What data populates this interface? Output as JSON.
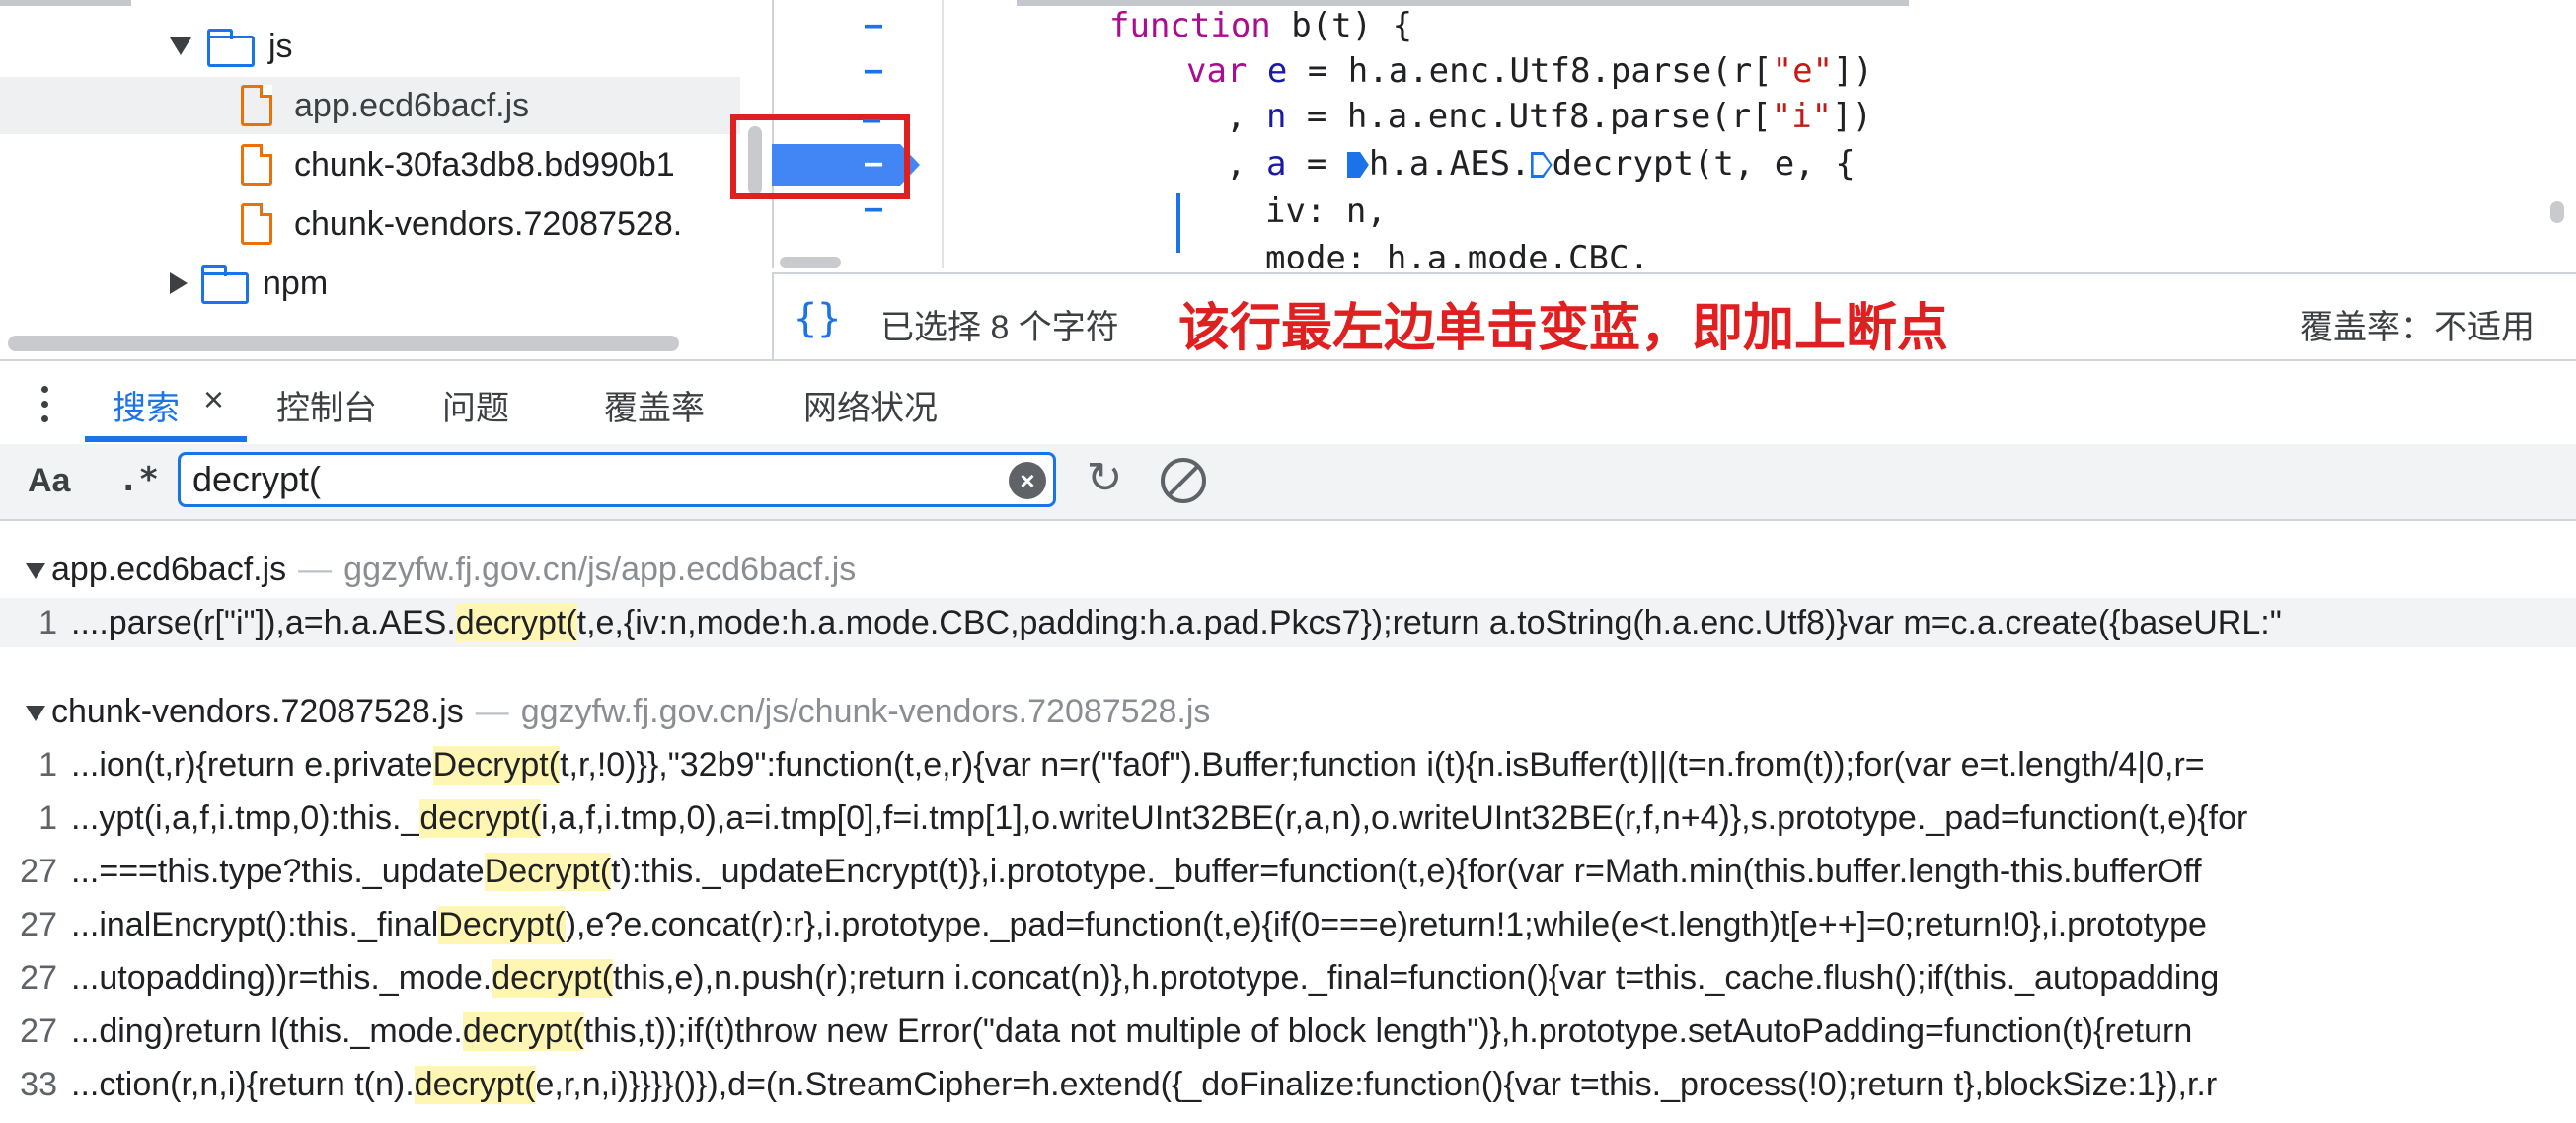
{
  "tree": {
    "folder_js": "js",
    "files": [
      "app.ecd6bacf.js",
      "chunk-30fa3db8.bd990b1",
      "chunk-vendors.72087528."
    ],
    "folder_npm": "npm"
  },
  "editor": {
    "lines": [
      {
        "kw": "function",
        "rest": " b(t) {"
      },
      {
        "kw": "var",
        "v": " e",
        "rest1": " = h.a.enc.Utf8.parse(r[",
        "s": "\"e\"",
        "rest2": "])"
      },
      {
        "pre": ", ",
        "v": "n",
        "rest1": " = h.a.enc.Utf8.parse(r[",
        "s": "\"i\"",
        "rest2": "])"
      },
      {
        "pre": ", ",
        "v": "a",
        "rest1": " = ",
        "p1": "h.a.AES.",
        "p2": "decrypt(t, e, {"
      },
      {
        "text": "iv: n,"
      },
      {
        "text": "mode: h.a.mode.CBC,"
      }
    ],
    "gutter_dashes": [
      "–",
      "–",
      "–",
      "–",
      "–"
    ]
  },
  "status": {
    "braces": "{}",
    "selection": "已选择 8 个字符",
    "annotation": "该行最左边单击变蓝，即加上断点",
    "coverage": "覆盖率：不适用"
  },
  "tabs": {
    "search": "搜索",
    "console": "控制台",
    "issues": "问题",
    "coverage": "覆盖率",
    "network": "网络状况",
    "close": "×"
  },
  "search": {
    "case_toggle": "Aa",
    "regex_toggle": ".*",
    "query": "decrypt(",
    "clear": "×",
    "refresh": "↻"
  },
  "results": {
    "groups": [
      {
        "file": "app.ecd6bacf.js",
        "url": "ggzyfw.fj.gov.cn/js/app.ecd6bacf.js",
        "rows": [
          {
            "line": "1",
            "pre": "....parse(r[\"i\"]),a=h.a.AES.",
            "match": "decrypt(",
            "post": "t,e,{iv:n,mode:h.a.mode.CBC,padding:h.a.pad.Pkcs7});return a.toString(h.a.enc.Utf8)}var m=c.a.create({baseURL:\""
          }
        ]
      },
      {
        "file": "chunk-vendors.72087528.js",
        "url": "ggzyfw.fj.gov.cn/js/chunk-vendors.72087528.js",
        "rows": [
          {
            "line": "1",
            "pre": "...ion(t,r){return e.private",
            "match": "Decrypt(",
            "post": "t,r,!0)}},\"32b9\":function(t,e,r){var n=r(\"fa0f\").Buffer;function i(t){n.isBuffer(t)||(t=n.from(t));for(var e=t.length/4|0,r="
          },
          {
            "line": "1",
            "pre": "...ypt(i,a,f,i.tmp,0):this._",
            "match": "decrypt(",
            "post": "i,a,f,i.tmp,0),a=i.tmp[0],f=i.tmp[1],o.writeUInt32BE(r,a,n),o.writeUInt32BE(r,f,n+4)},s.prototype._pad=function(t,e){for"
          },
          {
            "line": "27",
            "pre": "...===this.type?this._update",
            "match": "Decrypt(",
            "post": "t):this._updateEncrypt(t)},i.prototype._buffer=function(t,e){for(var r=Math.min(this.buffer.length-this.bufferOff"
          },
          {
            "line": "27",
            "pre": "...inalEncrypt():this._final",
            "match": "Decrypt(",
            "post": "),e?e.concat(r):r},i.prototype._pad=function(t,e){if(0===e)return!1;while(e<t.length)t[e++]=0;return!0},i.prototype"
          },
          {
            "line": "27",
            "pre": "...utopadding))r=this._mode.",
            "match": "decrypt(",
            "post": "this,e),n.push(r);return i.concat(n)},h.prototype._final=function(){var t=this._cache.flush();if(this._autopadding"
          },
          {
            "line": "27",
            "pre": "...ding)return l(this._mode.",
            "match": "decrypt(",
            "post": "this,t));if(t)throw new Error(\"data not multiple of block length\")},h.prototype.setAutoPadding=function(t){return"
          },
          {
            "line": "33",
            "pre": "...ction(r,n,i){return t(n).",
            "match": "decrypt(",
            "post": "e,r,n,i)}}}}()}),d=(n.StreamCipher=h.extend({_doFinalize:function(){var t=this._process(!0);return t},blockSize:1}),r.r"
          }
        ]
      }
    ]
  },
  "colors": {
    "accent": "#1a73e8",
    "annotation_red": "#e02020",
    "match_highlight": "#fff6b3",
    "file_icon": "#e8710a"
  }
}
